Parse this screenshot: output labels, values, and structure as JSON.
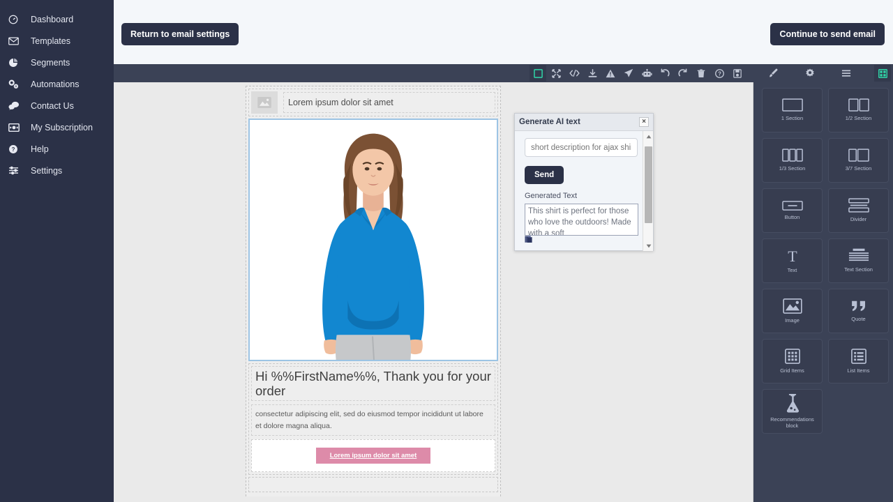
{
  "sidebar": {
    "items": [
      {
        "label": "Dashboard",
        "icon": "dashboard-icon"
      },
      {
        "label": "Templates",
        "icon": "envelope-icon"
      },
      {
        "label": "Segments",
        "icon": "pie-chart-icon"
      },
      {
        "label": "Automations",
        "icon": "gears-icon"
      },
      {
        "label": "Contact Us",
        "icon": "chat-bubbles-icon"
      },
      {
        "label": "My Subscription",
        "icon": "card-icon"
      },
      {
        "label": "Help",
        "icon": "question-circle-icon"
      },
      {
        "label": "Settings",
        "icon": "sliders-icon"
      }
    ]
  },
  "topbar": {
    "return_label": "Return to email settings",
    "continue_label": "Continue to send email"
  },
  "toolbar": {
    "items": [
      {
        "name": "preview-icon",
        "active": true
      },
      {
        "name": "fullscreen-icon",
        "active": false
      },
      {
        "name": "code-icon",
        "active": false
      },
      {
        "name": "download-icon",
        "active": false
      },
      {
        "name": "warning-icon",
        "active": false
      },
      {
        "name": "send-icon",
        "active": false
      },
      {
        "name": "robot-icon",
        "active": false
      },
      {
        "name": "undo-icon",
        "active": false
      },
      {
        "name": "redo-icon",
        "active": false
      },
      {
        "name": "trash-icon",
        "active": false
      },
      {
        "name": "help-icon",
        "active": false
      },
      {
        "name": "save-icon",
        "active": false
      },
      {
        "name": "brush-icon",
        "active": false
      },
      {
        "name": "gear-icon",
        "active": false
      },
      {
        "name": "menu-icon",
        "active": false
      },
      {
        "name": "grid-icon",
        "active": true
      }
    ]
  },
  "email": {
    "header_text": "Lorem ipsum dolor sit amet",
    "block_tools": [
      "move-up-icon",
      "drag-move-icon",
      "duplicate-icon",
      "delete-icon"
    ],
    "heading": "Hi %%FirstName%%, Thank you for your order",
    "paragraph": "consectetur adipiscing elit, sed do eiusmod tempor incididunt ut labore et dolore magna aliqua.",
    "cta_label": "Lorem ipsum dolor sit amet",
    "cta_color": "#dd8ba9",
    "selection_color": "#9cc4e4"
  },
  "ai_panel": {
    "title": "Generate AI text",
    "close_label": "×",
    "input_placeholder": "short description for ajax shirt",
    "input_value": "",
    "send_label": "Send",
    "generated_label": "Generated Text",
    "generated_text": "This shirt is perfect for those who love the outdoors! Made with a soft",
    "copy_icon": "copy-icon"
  },
  "blocks_panel": {
    "items": [
      {
        "label": "1 Section",
        "icon": "one-section-icon"
      },
      {
        "label": "1/2 Section",
        "icon": "half-section-icon"
      },
      {
        "label": "1/3 Section",
        "icon": "third-section-icon"
      },
      {
        "label": "3/7 Section",
        "icon": "three-seven-section-icon"
      },
      {
        "label": "Button",
        "icon": "button-icon"
      },
      {
        "label": "Divider",
        "icon": "divider-icon"
      },
      {
        "label": "Text",
        "icon": "text-icon"
      },
      {
        "label": "Text Section",
        "icon": "text-section-icon"
      },
      {
        "label": "Image",
        "icon": "image-icon"
      },
      {
        "label": "Quote",
        "icon": "quote-icon"
      },
      {
        "label": "Grid Items",
        "icon": "grid-items-icon"
      },
      {
        "label": "List Items",
        "icon": "list-items-icon"
      },
      {
        "label": "Recommendations block",
        "icon": "flask-icon"
      }
    ]
  },
  "colors": {
    "sidebar_bg": "#2b3147",
    "toolbar_bg": "#3b4256",
    "accent_green": "#2fd6a8",
    "block_select": "#4a9ae0",
    "topbar_bg": "#f4f7fa"
  }
}
